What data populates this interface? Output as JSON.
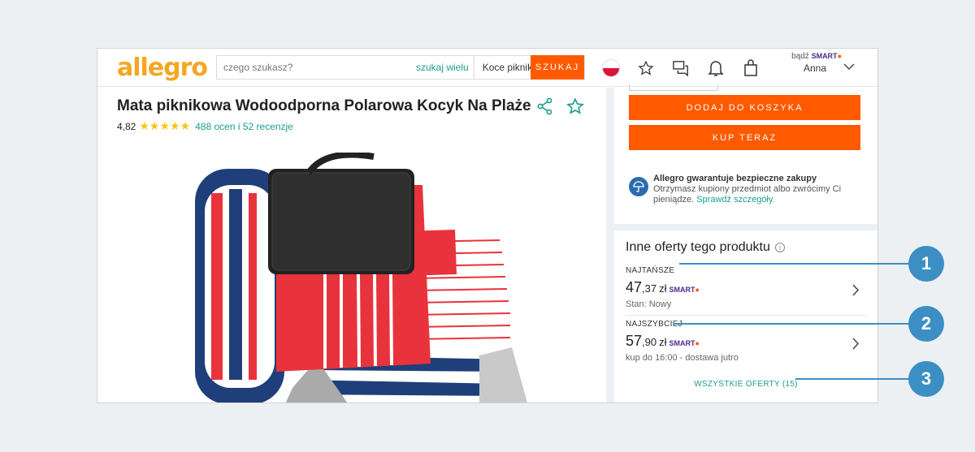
{
  "header": {
    "logo": "allegro",
    "search_placeholder": "czego szukasz?",
    "search_many": "szukaj wielu",
    "category": "Koce piknikowe, ...",
    "search_button": "SZUKAJ",
    "user_prefix": "bądź",
    "smart": "SMART",
    "user_name": "Anna"
  },
  "product": {
    "title": "Mata piknikowa Wodoodporna Polarowa Kocyk Na Plaże",
    "rating": "4,82",
    "stars": "★★★★★",
    "reviews": "488 ocen i 52 recenzje"
  },
  "purchase": {
    "add_to_cart": "DODAJ DO KOSZYKA",
    "buy_now": "KUP TERAZ",
    "guarantee_title": "Allegro gwarantuje bezpieczne zakupy",
    "guarantee_text": "Otrzymasz kupiony przedmiot albo zwrócimy Ci pieniądze.",
    "guarantee_link": "Sprawdź szczegóły."
  },
  "offers": {
    "heading": "Inne oferty tego produktu",
    "items": [
      {
        "label": "NAJTAŃSZE",
        "price_int": "47",
        "price_dec": ",37",
        "currency": "zł",
        "smart": "SMART",
        "sub": "Stan: Nowy"
      },
      {
        "label": "NAJSZYBCIEJ",
        "price_int": "57",
        "price_dec": ",90",
        "currency": "zł",
        "smart": "SMART",
        "sub": "kup do 16:00 - dostawa jutro"
      }
    ],
    "all_offers": "WSZYSTKIE OFERTY (15)"
  },
  "callouts": [
    "1",
    "2",
    "3"
  ],
  "colors": {
    "accent": "#ff5a00",
    "link": "#1d9d8f",
    "callout": "#3b8fc4",
    "smart": "#4a2c8f"
  }
}
